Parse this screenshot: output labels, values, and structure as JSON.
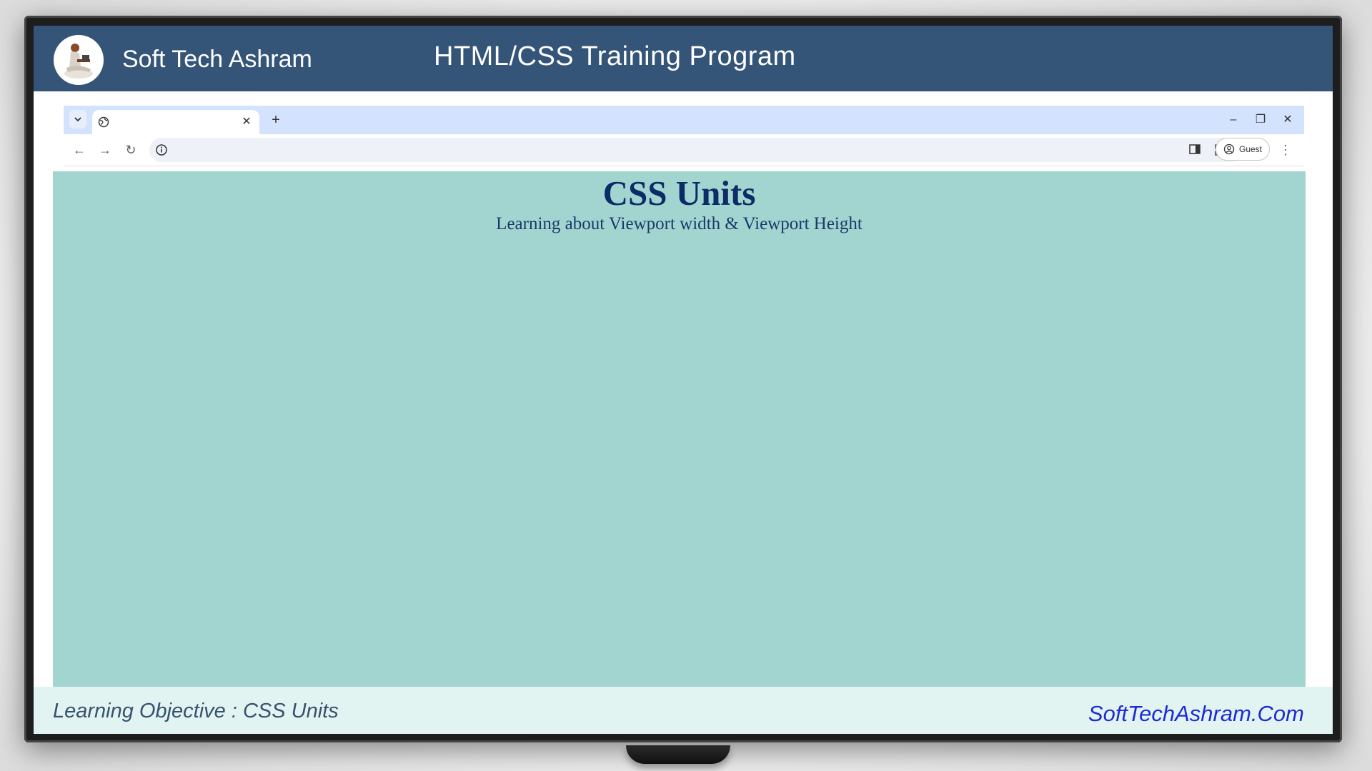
{
  "banner": {
    "brand": "Soft Tech Ashram",
    "program_title": "HTML/CSS Training Program",
    "color": "#345478"
  },
  "browser": {
    "tab": {
      "title": "",
      "favicon": "globe-icon",
      "close_glyph": "✕"
    },
    "new_tab_glyph": "+",
    "window_controls": {
      "minimize": "–",
      "restore": "❐",
      "close": "✕"
    },
    "toolbar": {
      "back": "←",
      "forward": "→",
      "reload": "↻",
      "address": "",
      "address_placeholder": "",
      "profile_label": "Guest",
      "menu": "⋮"
    },
    "tabstrip_color": "#d3e3fd"
  },
  "page": {
    "heading": "CSS Units",
    "subtitle": "Learning about Viewport width & Viewport Height",
    "background": "#a2d5cf",
    "text_color": "#0d2b66"
  },
  "footer": {
    "objective": "Learning Objective :  CSS Units",
    "site": "SoftTechAshram.Com",
    "site_color": "#1d2bd6"
  }
}
